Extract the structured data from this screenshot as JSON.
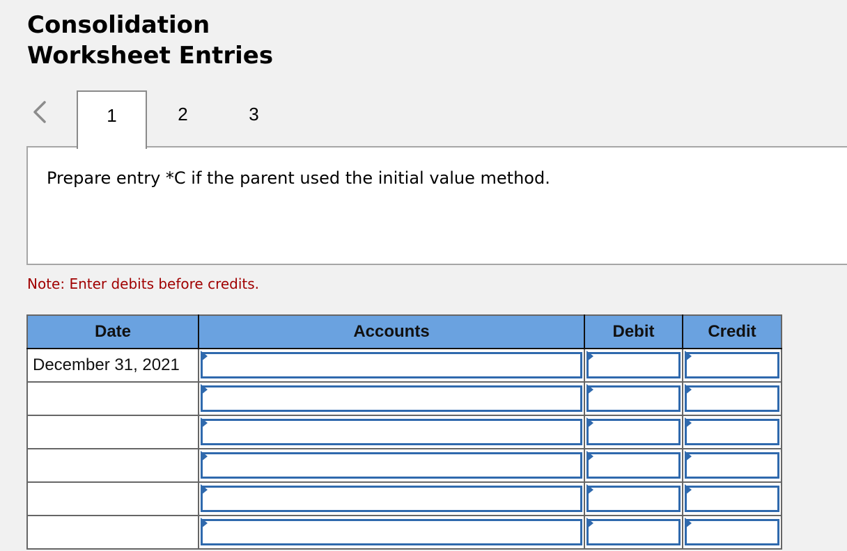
{
  "header": {
    "title_line1": "Consolidation",
    "title_line2": "Worksheet Entries"
  },
  "tabs": {
    "prev_icon": "chevron-left-icon",
    "items": [
      {
        "label": "1",
        "active": true
      },
      {
        "label": "2",
        "active": false
      },
      {
        "label": "3",
        "active": false
      }
    ]
  },
  "question": {
    "text": "Prepare entry *C if the parent used the initial value method."
  },
  "note": {
    "text": "Note: Enter debits before credits.",
    "color": "#a00000"
  },
  "journal": {
    "columns": [
      "Date",
      "Accounts",
      "Debit",
      "Credit"
    ],
    "header_color": "#6aa2e0",
    "input_border_color": "#2f69ad",
    "rows": [
      {
        "date": "December 31, 2021",
        "account": "",
        "debit": "",
        "credit": ""
      },
      {
        "date": "",
        "account": "",
        "debit": "",
        "credit": ""
      },
      {
        "date": "",
        "account": "",
        "debit": "",
        "credit": ""
      },
      {
        "date": "",
        "account": "",
        "debit": "",
        "credit": ""
      },
      {
        "date": "",
        "account": "",
        "debit": "",
        "credit": ""
      },
      {
        "date": "",
        "account": "",
        "debit": "",
        "credit": ""
      }
    ]
  }
}
